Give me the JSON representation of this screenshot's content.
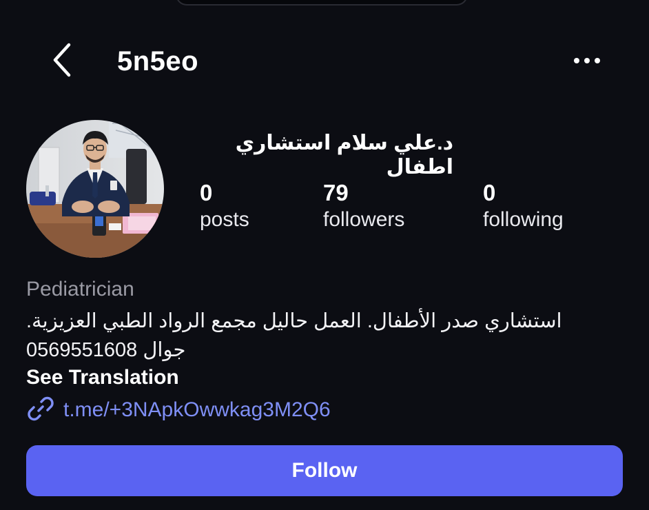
{
  "header": {
    "back_icon": "chevron-left-icon",
    "username": "5n5eo",
    "more_icon": "ellipsis-icon"
  },
  "profile": {
    "display_name": "د.علي سلام استشاري اطفال",
    "stats": {
      "posts": {
        "value": "0",
        "label": "posts"
      },
      "followers": {
        "value": "79",
        "label": "followers"
      },
      "following": {
        "value": "0",
        "label": "following"
      }
    },
    "category": "Pediatrician",
    "bio_line_1": "استشاري صدر الأطفال. العمل حاليل مجمع الرواد الطبي العزيزية.",
    "bio_line_2": "جوال 0569551608",
    "see_translation": "See Translation",
    "link_icon": "link-icon",
    "link": "t.me/+3NApkOwwkag3M2Q6"
  },
  "actions": {
    "follow_label": "Follow"
  },
  "colors": {
    "background": "#0c0d13",
    "accent": "#5a63f2",
    "link": "#7f8ff5",
    "muted_text": "#9a9aa4"
  }
}
